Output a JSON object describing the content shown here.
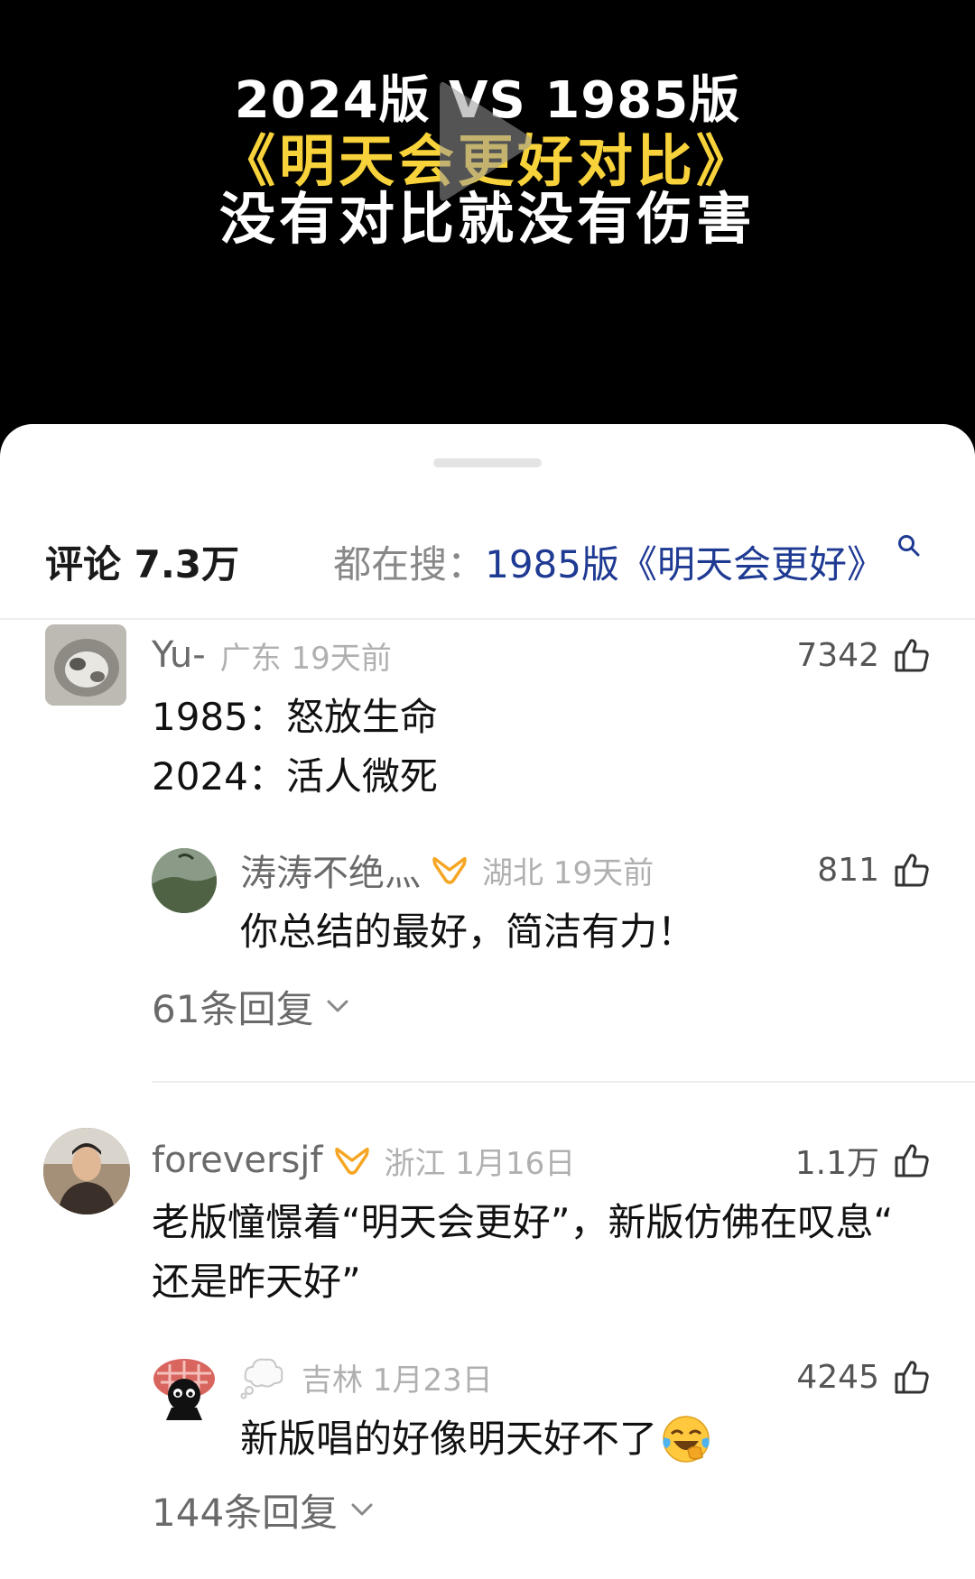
{
  "video": {
    "title_line1": "2024版 VS 1985版",
    "title_line2": "《明天会更好对比》",
    "title_line3": "没有对比就没有伤害"
  },
  "comments_header": {
    "title": "评论 7.3万",
    "search_label": "都在搜：",
    "search_query": "1985版《明天会更好》"
  },
  "comments": [
    {
      "user": "Yu-",
      "location_time": "广东 19天前",
      "likes": "7342",
      "text_lines": [
        "1985：怒放生命",
        "2024：活人微死"
      ],
      "reply": {
        "user": "涛涛不绝灬",
        "location_time": "湖北 19天前",
        "likes": "811",
        "text": "你总结的最好，简洁有力！"
      },
      "reply_count": "61条回复"
    },
    {
      "user": "foreversjf",
      "location_time": "浙江 1月16日",
      "likes": "1.1万",
      "text_lines": [
        "老版憧憬着“明天会更好”，新版仿佛在叹息“",
        "还是昨天好”"
      ],
      "reply": {
        "user": "",
        "location_time": "吉林 1月23日",
        "likes": "4245",
        "text": "新版唱的好像明天好不了"
      },
      "reply_count": "144条回复"
    }
  ],
  "colors": {
    "accent_link": "#1f3a93",
    "badge_orange": "#f5a623",
    "title_yellow": "#f7d23a"
  }
}
